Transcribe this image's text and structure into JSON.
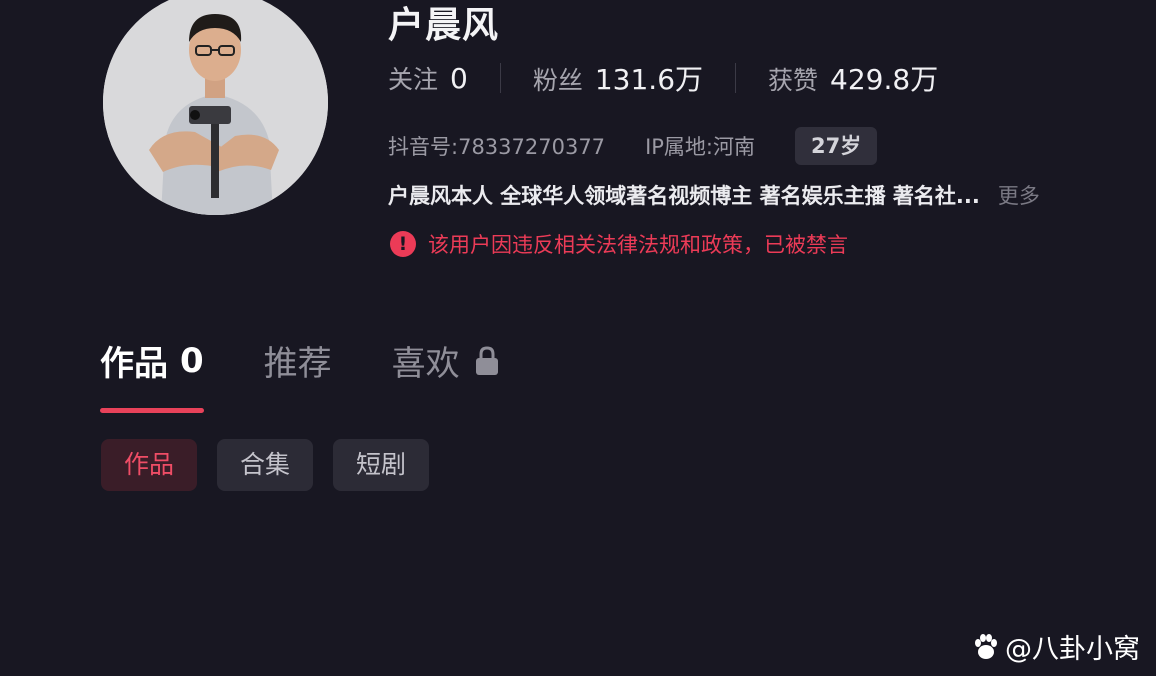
{
  "profile": {
    "name": "户晨风",
    "stats": [
      {
        "label": "关注",
        "value": "0"
      },
      {
        "label": "粉丝",
        "value": "131.6万"
      },
      {
        "label": "获赞",
        "value": "429.8万"
      }
    ],
    "douyin_id_label": "抖音号:",
    "douyin_id": "78337270377",
    "ip_label": "IP属地:",
    "ip_location": "河南",
    "age": "27岁",
    "bio": "户晨风本人 全球华人领域著名视频博主 著名娱乐主播 著名社...",
    "more_label": "更多",
    "warning_text": "该用户因违反相关法律法规和政策，已被禁言",
    "warning_icon": "!"
  },
  "tabs": [
    {
      "label": "作品",
      "count": "0",
      "active": true
    },
    {
      "label": "推荐",
      "count": "",
      "active": false
    },
    {
      "label": "喜欢",
      "count": "",
      "active": false,
      "icon": "lock-icon"
    }
  ],
  "sub_tabs": [
    {
      "label": "作品",
      "active": true
    },
    {
      "label": "合集",
      "active": false
    },
    {
      "label": "短剧",
      "active": false
    }
  ],
  "watermark": {
    "text": "@八卦小窝",
    "icon": "paw-icon"
  },
  "colors": {
    "background": "#181722",
    "accent": "#e8425a",
    "warning": "#ec3b57"
  }
}
